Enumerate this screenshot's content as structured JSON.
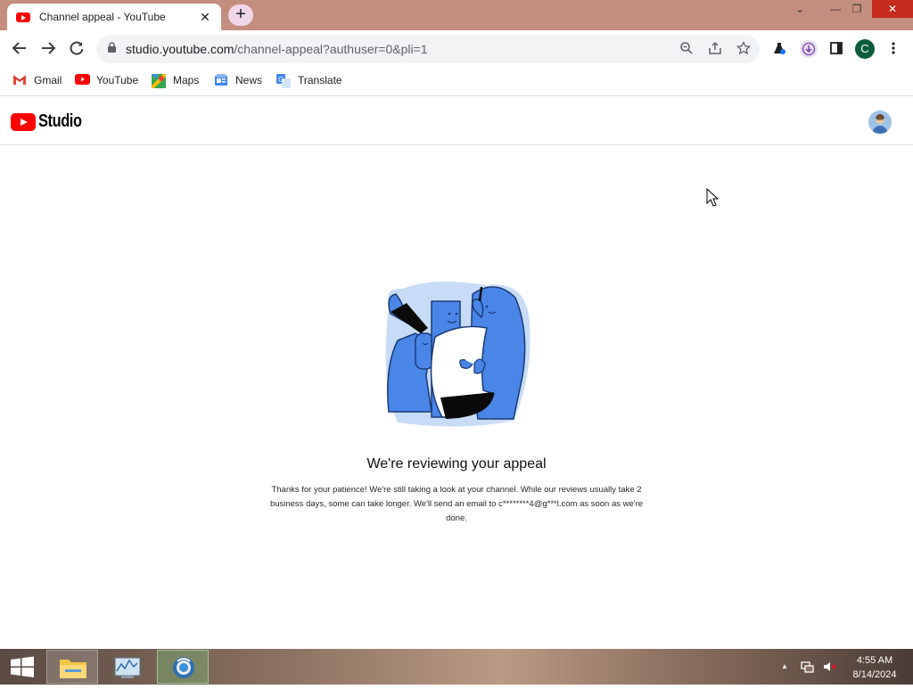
{
  "browser": {
    "tab_title": "Channel appeal - YouTube",
    "tab_close": "✕",
    "new_tab": "+",
    "window_controls": {
      "dropdown": "⌄",
      "minimize": "—",
      "restore": "❐",
      "close": "✕"
    },
    "url_host": "studio.youtube.com",
    "url_path": "/channel-appeal?authuser=0&pli=1",
    "profile_initial": "C",
    "icons": [
      "back-icon",
      "forward-icon",
      "reload-icon",
      "lock-icon",
      "zoom-icon",
      "share-icon",
      "star-icon",
      "extension-icon",
      "download-icon",
      "sidepanel-icon",
      "menu-icon"
    ]
  },
  "bookmarks": [
    {
      "label": "Gmail",
      "icon": "gmail-icon"
    },
    {
      "label": "YouTube",
      "icon": "youtube-icon"
    },
    {
      "label": "Maps",
      "icon": "maps-icon"
    },
    {
      "label": "News",
      "icon": "news-icon"
    },
    {
      "label": "Translate",
      "icon": "translate-icon"
    }
  ],
  "studio": {
    "logo_text": "Studio",
    "heading": "We're reviewing your appeal",
    "body": "Thanks for your patience! We're still taking a look at your channel. While our reviews usually take 2 business days, some can take longer. We'll send an email to c********4@g***l.com as soon as we're done."
  },
  "taskbar": {
    "time": "4:55 AM",
    "date": "8/14/2024",
    "tray_arrow": "▲"
  },
  "colors": {
    "youtube_red": "#ff0000",
    "illustration_blue": "#4a86e8",
    "tab_strip": "#c48e7e"
  }
}
